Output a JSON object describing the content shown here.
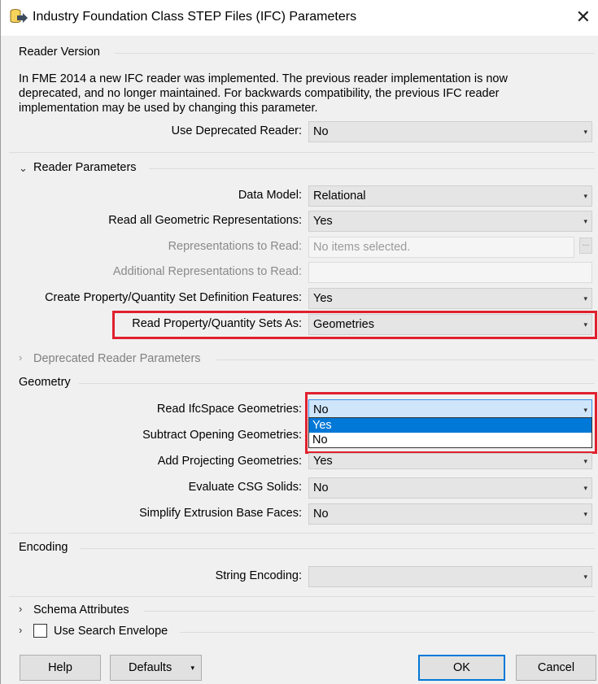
{
  "window": {
    "title": "Industry Foundation Class STEP Files (IFC) Parameters",
    "close": "✕"
  },
  "reader_version": {
    "heading": "Reader Version",
    "description": "In FME 2014 a new IFC reader was implemented. The previous reader implementation is now deprecated, and no longer maintained. For backwards compatibility, the previous IFC reader implementation may be used by changing this parameter.",
    "use_deprecated_label": "Use Deprecated Reader:",
    "use_deprecated_value": "No"
  },
  "reader_parameters": {
    "heading": "Reader Parameters",
    "data_model_label": "Data Model:",
    "data_model_value": "Relational",
    "read_all_geom_label": "Read all Geometric Representations:",
    "read_all_geom_value": "Yes",
    "reps_label": "Representations to Read:",
    "reps_placeholder": "No items selected.",
    "reps_button": "...",
    "additional_reps_label": "Additional Representations to Read:",
    "additional_reps_value": "",
    "create_psets_label": "Create Property/Quantity Set Definition Features:",
    "create_psets_value": "Yes",
    "read_psets_as_label": "Read Property/Quantity Sets As:",
    "read_psets_as_value": "Geometries"
  },
  "deprecated_parameters": {
    "heading": "Deprecated Reader Parameters"
  },
  "geometry": {
    "heading": "Geometry",
    "ifcspace_label": "Read IfcSpace Geometries:",
    "ifcspace_value": "No",
    "ifcspace_options": [
      "Yes",
      "No"
    ],
    "subtract_label": "Subtract Opening Geometries:",
    "projecting_label": "Add Projecting Geometries:",
    "projecting_value": "Yes",
    "csg_label": "Evaluate CSG Solids:",
    "csg_value": "No",
    "simplify_label": "Simplify Extrusion Base Faces:",
    "simplify_value": "No"
  },
  "encoding": {
    "heading": "Encoding",
    "string_encoding_label": "String Encoding:",
    "string_encoding_value": ""
  },
  "schema_attributes": {
    "heading": "Schema Attributes"
  },
  "search_envelope": {
    "label": "Use Search Envelope",
    "checked": false
  },
  "buttons": {
    "help": "Help",
    "defaults": "Defaults",
    "ok": "OK",
    "cancel": "Cancel"
  },
  "colors": {
    "highlight_box": "#e0202e",
    "selected_option": "#0078d7",
    "dialog_bg": "#f0f0f0"
  }
}
